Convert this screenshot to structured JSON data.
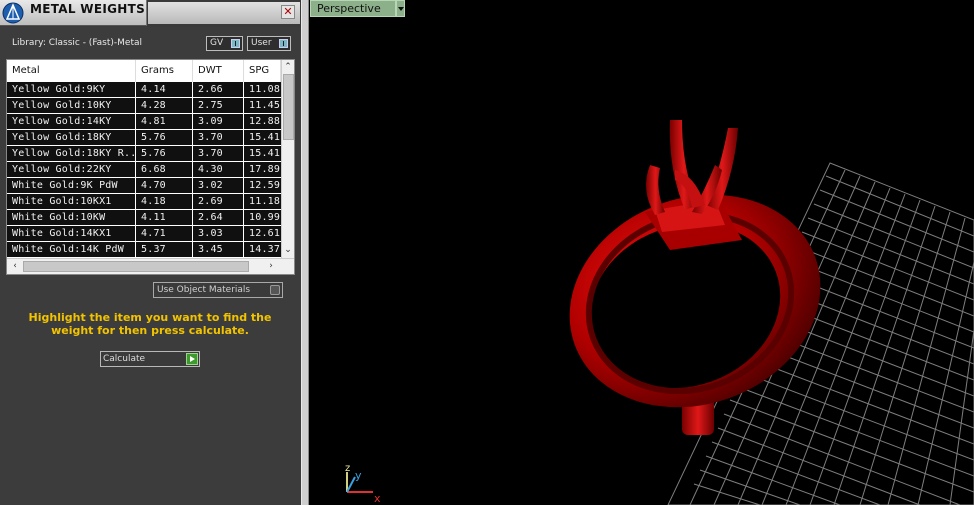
{
  "panel": {
    "title": "METAL WEIGHTS",
    "close_glyph": "✕",
    "library_label": "Library: Classic - (Fast)-Metal",
    "gv_label": "GV",
    "user_label": "User",
    "table": {
      "columns": [
        "Metal",
        "Grams",
        "DWT",
        "SPG"
      ],
      "rows": [
        [
          "Yellow Gold:9KY",
          "4.14",
          "2.66",
          "11.08"
        ],
        [
          "Yellow Gold:10KY",
          "4.28",
          "2.75",
          "11.45"
        ],
        [
          "Yellow Gold:14KY",
          "4.81",
          "3.09",
          "12.88"
        ],
        [
          "Yellow Gold:18KY",
          "5.76",
          "3.70",
          "15.41"
        ],
        [
          "Yellow Gold:18KY R...",
          "5.76",
          "3.70",
          "15.41"
        ],
        [
          "Yellow Gold:22KY",
          "6.68",
          "4.30",
          "17.89"
        ],
        [
          "White Gold:9K PdW",
          "4.70",
          "3.02",
          "12.59"
        ],
        [
          "White Gold:10KX1",
          "4.18",
          "2.69",
          "11.18"
        ],
        [
          "White Gold:10KW",
          "4.11",
          "2.64",
          "10.99"
        ],
        [
          "White Gold:14KX1",
          "4.71",
          "3.03",
          "12.61"
        ],
        [
          "White Gold:14K PdW",
          "5.37",
          "3.45",
          "14.37"
        ]
      ]
    },
    "use_object_materials_label": "Use Object Materials",
    "hint_text": "Highlight the item you want to find the weight for then press calculate.",
    "calculate_label": "Calculate"
  },
  "viewport": {
    "view_label": "Perspective",
    "axis_labels": {
      "x": "x",
      "y": "y",
      "z": "z"
    }
  },
  "colors": {
    "panel_bg": "#3c3c3c",
    "hint": "#f2c400",
    "ring": "#c00000",
    "grid": "#8a8a8a",
    "viewport_label_bg": "#8bb08a"
  }
}
